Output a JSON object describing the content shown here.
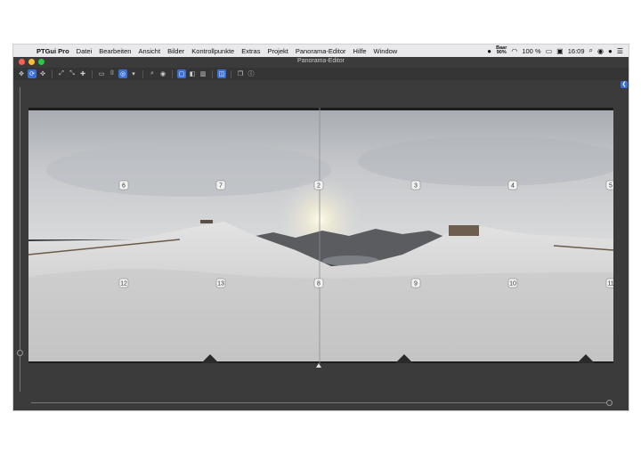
{
  "menubar": {
    "app_name": "PTGui Pro",
    "items": [
      "Datei",
      "Bearbeiten",
      "Ansicht",
      "Bilder",
      "Kontrollpunkte",
      "Extras",
      "Projekt",
      "Panorama-Editor",
      "Hilfe",
      "Window"
    ],
    "status": {
      "battery_badge_line1": "Baar",
      "battery_badge_line2": "90%",
      "battery_percent": "100 %",
      "clock": "16:09"
    }
  },
  "window": {
    "title": "Panorama-Editor",
    "traffic_lights": {
      "close": "#ff5f57",
      "minimize": "#febc2e",
      "zoom": "#28c840"
    }
  },
  "toolbar": {
    "accent_color": "#3a6fd8",
    "buttons": [
      {
        "name": "move-tool-icon",
        "glyph": "✥",
        "active": false
      },
      {
        "name": "rotate-tool-icon",
        "glyph": "⟳",
        "active": true
      },
      {
        "name": "numbered-tool-icon",
        "glyph": "✜",
        "active": false
      },
      {
        "name": "fit-panorama-icon",
        "glyph": "⤢",
        "active": false
      },
      {
        "name": "shrink-panorama-icon",
        "glyph": "⤡",
        "active": false
      },
      {
        "name": "center-point-icon",
        "glyph": "✚",
        "active": false
      },
      {
        "name": "rectangle-icon",
        "glyph": "▭",
        "active": false
      },
      {
        "name": "cylinder-icon",
        "glyph": "⌷",
        "active": false
      },
      {
        "name": "sphere-icon",
        "glyph": "◎",
        "active": true
      },
      {
        "name": "dropdown-icon",
        "glyph": "▾",
        "active": false
      },
      {
        "name": "zoom-icon",
        "glyph": "⌕",
        "active": false
      },
      {
        "name": "eye-icon",
        "glyph": "◉",
        "active": false
      },
      {
        "name": "view-single-icon",
        "glyph": "▢",
        "active": true
      },
      {
        "name": "view-half-icon",
        "glyph": "◧",
        "active": false
      },
      {
        "name": "view-grid-icon",
        "glyph": "▥",
        "active": false
      },
      {
        "name": "split-view-icon",
        "glyph": "◫",
        "active": true
      },
      {
        "name": "layers-icon",
        "glyph": "❐",
        "active": false
      },
      {
        "name": "info-icon",
        "glyph": "ⓘ",
        "active": false
      }
    ]
  },
  "panorama": {
    "image_numbers": [
      "6",
      "7",
      "2",
      "3",
      "4",
      "5",
      "12",
      "13",
      "8",
      "9",
      "10",
      "11"
    ]
  }
}
